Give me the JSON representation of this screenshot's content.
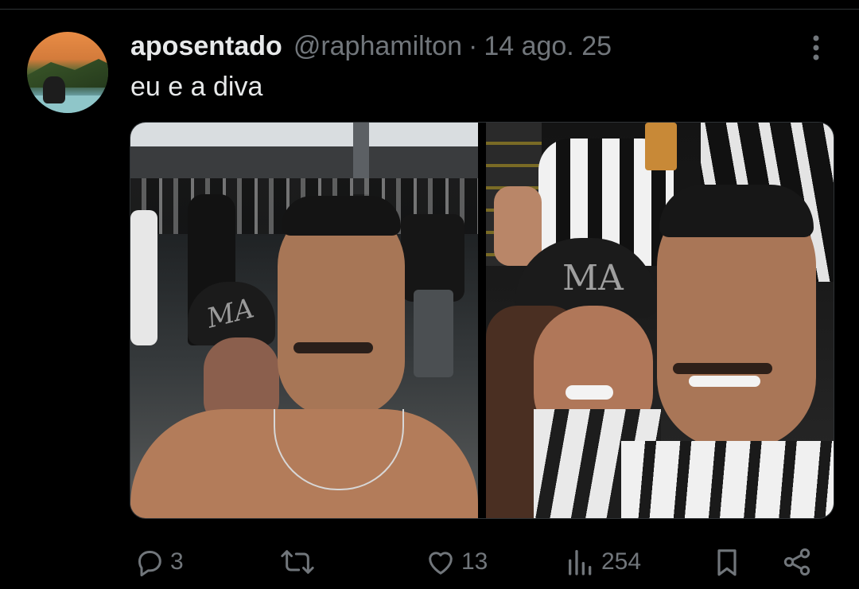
{
  "tweet": {
    "display_name": "aposentado",
    "handle": "@raphamilton",
    "separator": "·",
    "date": "14 ago. 25",
    "text": "eu e a diva"
  },
  "actions": {
    "replies": "3",
    "reposts": "",
    "likes": "13",
    "views": "254"
  },
  "icons": {
    "more": "more-vertical-icon",
    "reply": "reply-icon",
    "repost": "repost-icon",
    "like": "heart-icon",
    "views": "views-icon",
    "bookmark": "bookmark-icon",
    "share": "share-icon"
  },
  "photo_text": {
    "cap_logo_1": "MA",
    "cap_logo_2": "MA"
  },
  "colors": {
    "background": "#000000",
    "primary_text": "#e7e9ea",
    "secondary_text": "#71767b"
  }
}
